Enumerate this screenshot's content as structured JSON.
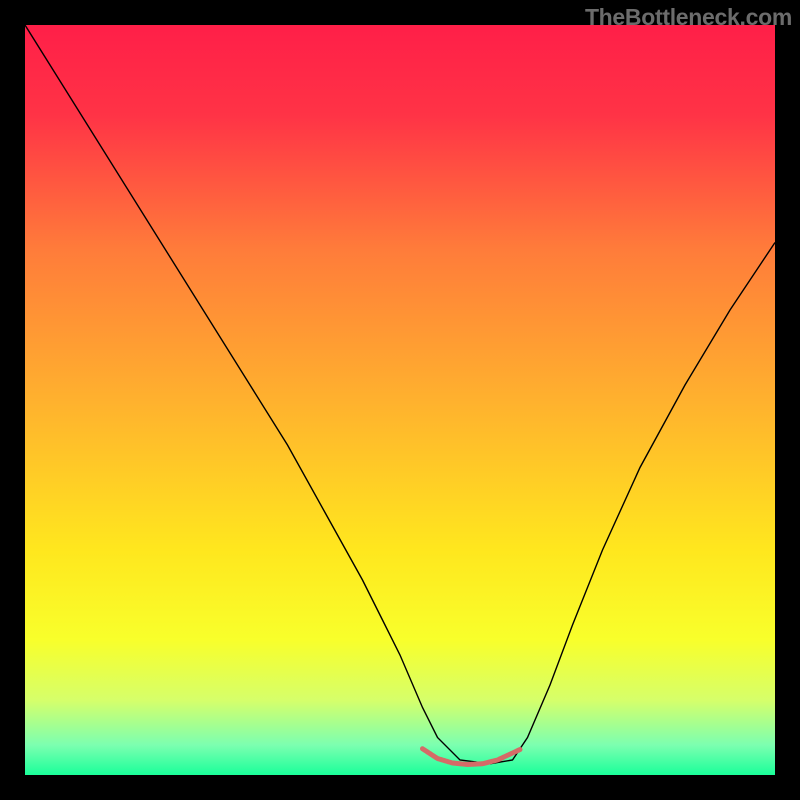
{
  "watermark": "TheBottleneck.com",
  "chart_data": {
    "type": "line",
    "title": "",
    "xlabel": "",
    "ylabel": "",
    "xlim": [
      0,
      100
    ],
    "ylim": [
      0,
      100
    ],
    "background_gradient": {
      "orientation": "vertical",
      "stops": [
        {
          "pos": 0.0,
          "color": "#ff1f48"
        },
        {
          "pos": 0.12,
          "color": "#ff3346"
        },
        {
          "pos": 0.3,
          "color": "#ff7c3a"
        },
        {
          "pos": 0.5,
          "color": "#ffb12e"
        },
        {
          "pos": 0.7,
          "color": "#ffe71e"
        },
        {
          "pos": 0.82,
          "color": "#f8ff2b"
        },
        {
          "pos": 0.9,
          "color": "#d6ff6a"
        },
        {
          "pos": 0.96,
          "color": "#7cffb0"
        },
        {
          "pos": 1.0,
          "color": "#1aff9a"
        }
      ]
    },
    "series": [
      {
        "name": "bottleneck-curve",
        "color": "#000000",
        "width": 1.4,
        "x": [
          0,
          5,
          10,
          15,
          20,
          25,
          30,
          35,
          40,
          45,
          50,
          53,
          55,
          58,
          62,
          65,
          67,
          70,
          73,
          77,
          82,
          88,
          94,
          100
        ],
        "y": [
          100,
          92,
          84,
          76,
          68,
          60,
          52,
          44,
          35,
          26,
          16,
          9,
          5,
          2,
          1.5,
          2,
          5,
          12,
          20,
          30,
          41,
          52,
          62,
          71
        ]
      },
      {
        "name": "optimal-band",
        "color": "#d56b67",
        "width": 5,
        "dash": true,
        "x": [
          53,
          55,
          57,
          59,
          61,
          63,
          66
        ],
        "y": [
          3.5,
          2.2,
          1.6,
          1.4,
          1.5,
          2.0,
          3.4
        ]
      }
    ]
  }
}
